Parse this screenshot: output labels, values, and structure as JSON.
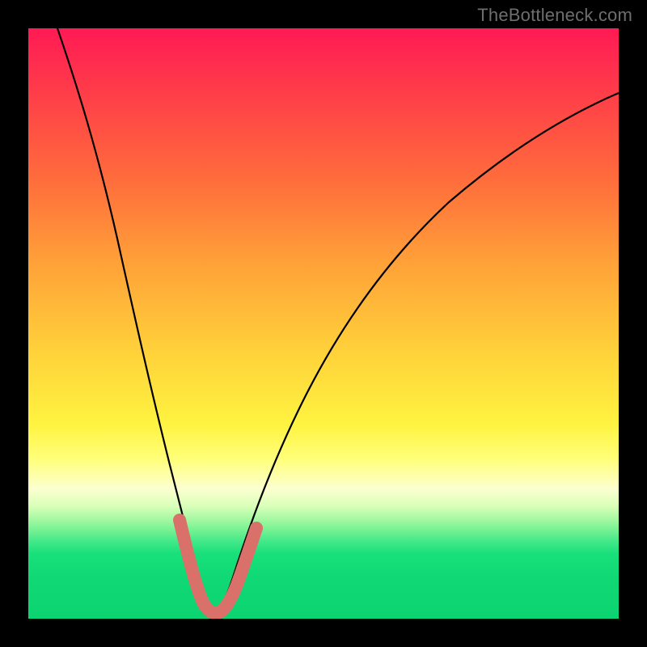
{
  "watermark": "TheBottleneck.com",
  "chart_data": {
    "type": "line",
    "title": "",
    "xlabel": "",
    "ylabel": "",
    "xlim": [
      0,
      100
    ],
    "ylim": [
      0,
      100
    ],
    "series": [
      {
        "name": "bottleneck-curve",
        "x": [
          5,
          9,
          12,
          15,
          18,
          21,
          23,
          25,
          27,
          28,
          29,
          30,
          32,
          34,
          36,
          40,
          45,
          50,
          56,
          63,
          72,
          82,
          92,
          100
        ],
        "values": [
          100,
          86,
          75,
          64,
          53,
          41,
          32,
          22,
          12,
          6,
          2,
          1,
          1,
          2,
          6,
          14,
          24,
          33,
          42,
          51,
          60,
          68,
          75,
          80
        ]
      },
      {
        "name": "highlight-bottom",
        "x": [
          25,
          26.5,
          28,
          29,
          30,
          31,
          32,
          33.5,
          35
        ],
        "values": [
          17,
          10,
          5,
          2.5,
          2,
          2.5,
          4,
          8,
          14
        ]
      }
    ],
    "gradient_stops": [
      {
        "pos": 0,
        "color": "#ff1a54"
      },
      {
        "pos": 25,
        "color": "#ff6a3c"
      },
      {
        "pos": 55,
        "color": "#ffd23a"
      },
      {
        "pos": 78,
        "color": "#fcffd0"
      },
      {
        "pos": 90,
        "color": "#18e07a"
      },
      {
        "pos": 100,
        "color": "#0bd471"
      }
    ]
  }
}
